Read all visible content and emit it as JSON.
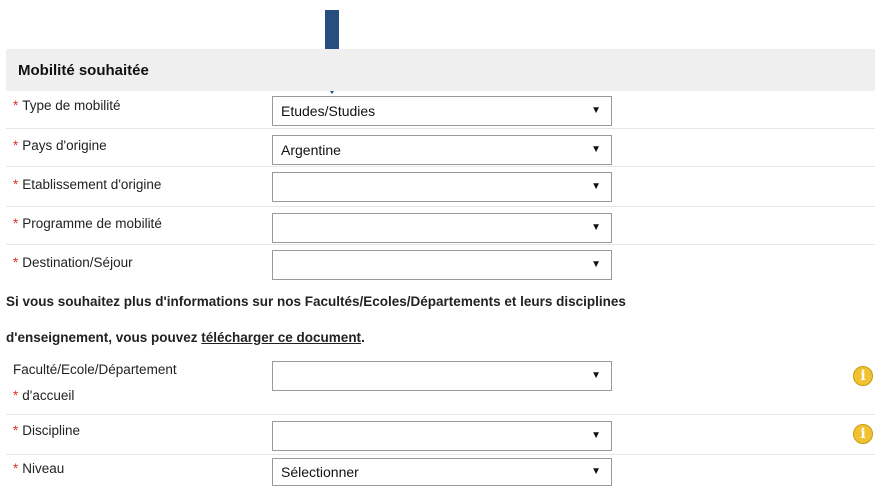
{
  "section": {
    "title": "Mobilité souhaitée"
  },
  "required_marker": "*",
  "caret_glyph": "▼",
  "fields": {
    "type_mobilite": {
      "label": "Type de mobilité",
      "value": "Etudes/Studies"
    },
    "pays_origine": {
      "label": "Pays d'origine",
      "value": "Argentine"
    },
    "etablissement_origine": {
      "label": "Etablissement d'origine",
      "value": ""
    },
    "programme_mobilite": {
      "label": "Programme de mobilité",
      "value": ""
    },
    "destination_sejour": {
      "label": "Destination/Séjour",
      "value": ""
    },
    "faculte_accueil": {
      "label_line1": "Faculté/Ecole/Département",
      "label_line2": "d'accueil",
      "value": ""
    },
    "discipline": {
      "label": "Discipline",
      "value": ""
    },
    "niveau": {
      "label": "Niveau",
      "value": "Sélectionner"
    }
  },
  "info": {
    "line1": "Si vous souhaitez plus d'informations sur nos Facultés/Ecoles/Départements et leurs disciplines",
    "line2_prefix": "d'enseignement, vous pouvez ",
    "link_text": "télécharger ce document",
    "line2_suffix": "."
  },
  "info_icon_glyph": "i",
  "colors": {
    "arrow": "#274e7c",
    "required": "#e0302b",
    "info_icon": "#f0c230",
    "header_bg": "#efefef"
  },
  "icons": {
    "arrow": "down-arrow-icon",
    "info": "info-icon",
    "caret": "chevron-down-icon"
  }
}
